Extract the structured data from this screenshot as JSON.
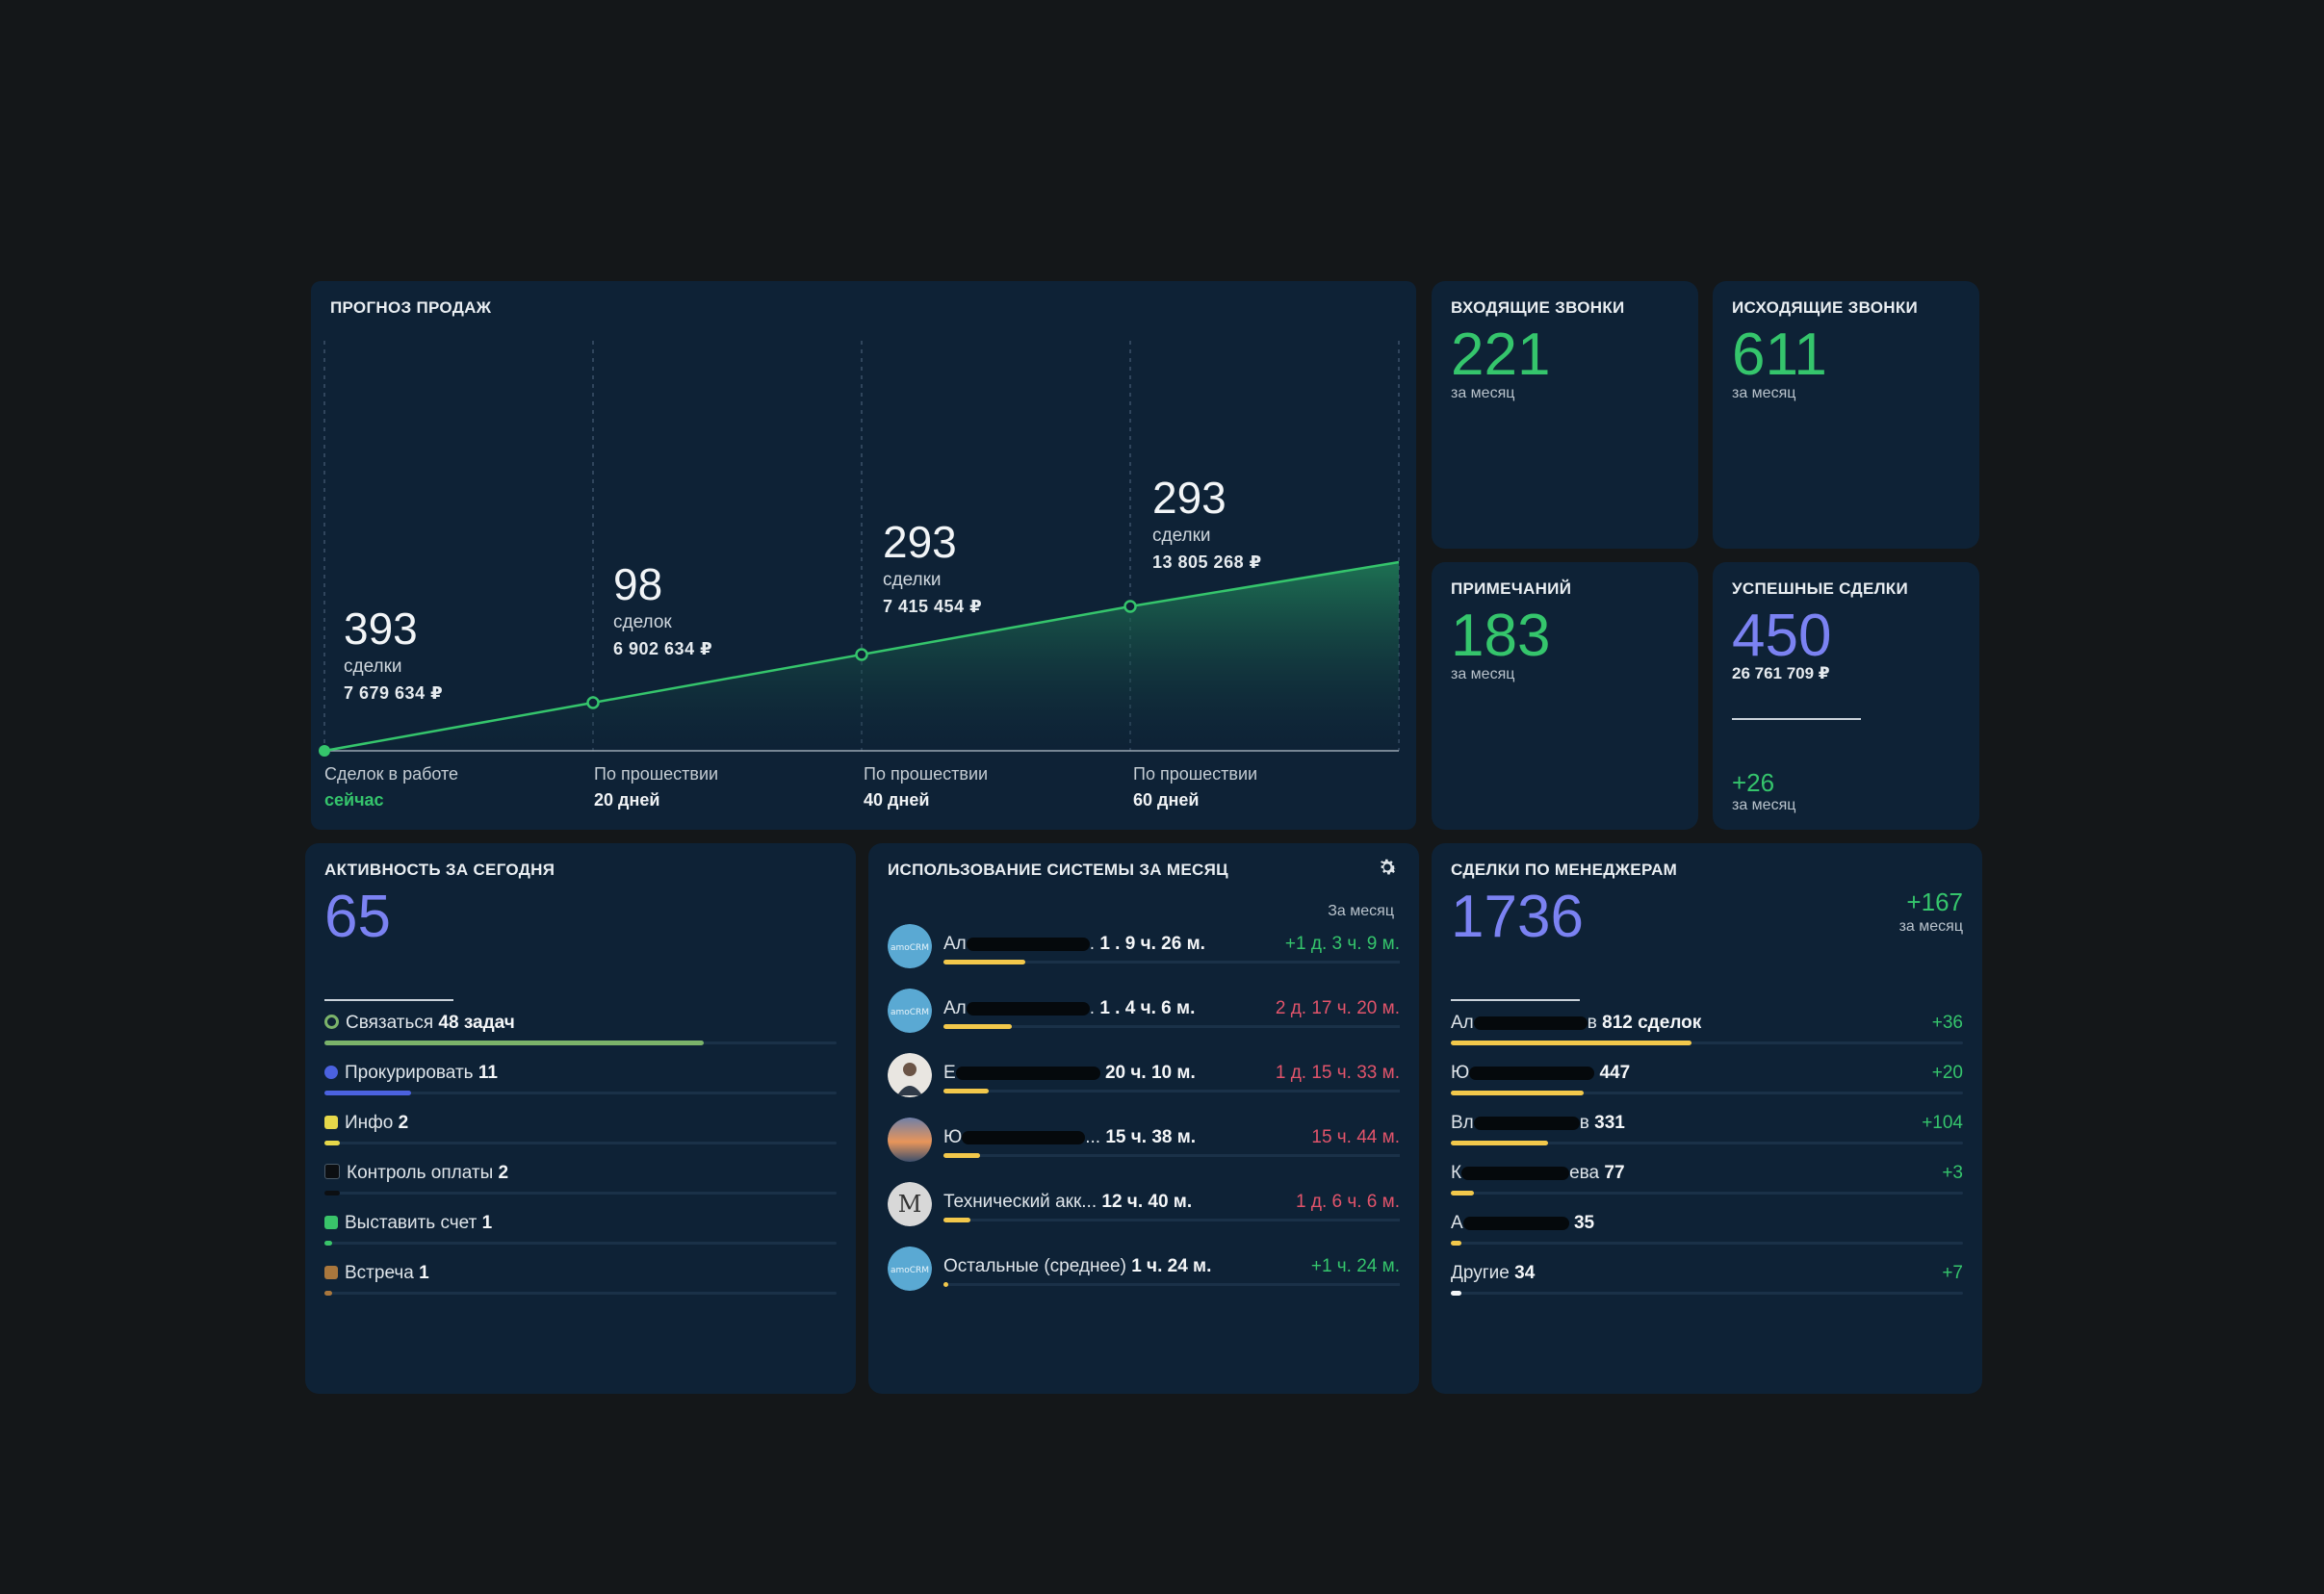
{
  "forecast": {
    "title": "ПРОГНОЗ ПРОДАЖ",
    "stages": [
      {
        "count": "393",
        "unit": "сделки",
        "amount": "7 679 634 ₽",
        "caption": "Сделок в работе",
        "when": "сейчас",
        "value": 0.0
      },
      {
        "count": "98",
        "unit": "сделок",
        "amount": "6 902 634 ₽",
        "caption": "По прошествии",
        "when": "20 дней",
        "value": 0.25
      },
      {
        "count": "293",
        "unit": "сделки",
        "amount": "7 415 454 ₽",
        "caption": "По прошествии",
        "when": "40 дней",
        "value": 0.5
      },
      {
        "count": "293",
        "unit": "сделки",
        "amount": "13 805 268 ₽",
        "caption": "По прошествии",
        "when": "60 дней",
        "value": 0.75
      }
    ],
    "end_value": 0.98,
    "line_color": "#35c56c"
  },
  "stats": {
    "incoming": {
      "title": "ВХОДЯЩИЕ ЗВОНКИ",
      "value": "221",
      "sub": "за месяц"
    },
    "outgoing": {
      "title": "ИСХОДЯЩИЕ ЗВОНКИ",
      "value": "611",
      "sub": "за месяц"
    },
    "notes": {
      "title": "ПРИМЕЧАНИЙ",
      "value": "183",
      "sub": "за месяц"
    },
    "success": {
      "title": "УСПЕШНЫЕ СДЕЛКИ",
      "value": "450",
      "amount": "26 761 709 ₽",
      "delta": "+26",
      "delta_sub": "за месяц"
    }
  },
  "activity": {
    "title": "АКТИВНОСТЬ ЗА СЕГОДНЯ",
    "total": "65",
    "items": [
      {
        "icon": "refresh-icon",
        "label": "Связаться",
        "count": "48 задач",
        "share": 0.74,
        "color": "#7bb36a"
      },
      {
        "icon": "check-circle-icon",
        "label": "Прокурировать",
        "count": "11",
        "share": 0.17,
        "color": "#4b62e0"
      },
      {
        "icon": "chat-icon",
        "label": "Инфо",
        "count": "2",
        "share": 0.03,
        "color": "#e6d84a"
      },
      {
        "icon": "square-icon",
        "label": "Контроль оплаты",
        "count": "2",
        "share": 0.03,
        "color": "#0c0f12"
      },
      {
        "icon": "invoice-icon",
        "label": "Выставить счет",
        "count": "1",
        "share": 0.015,
        "color": "#39c46a"
      },
      {
        "icon": "briefcase-icon",
        "label": "Встреча",
        "count": "1",
        "share": 0.015,
        "color": "#a9773d"
      }
    ]
  },
  "usage": {
    "title": "ИСПОЛЬЗОВАНИЕ СИСТЕМЫ ЗА МЕСЯЦ",
    "period": "За месяц",
    "rows": [
      {
        "avatar": "logo",
        "name_prefix": "Ал",
        "name_suffix": ".",
        "time": "1 . 9 ч. 26 м.",
        "delta": "+1 д. 3 ч. 9 м.",
        "trend": "pos",
        "share": 0.18
      },
      {
        "avatar": "logo",
        "name_prefix": "Ал",
        "name_suffix": ".",
        "time": "1 . 4 ч. 6 м.",
        "delta": "2 д. 17 ч. 20 м.",
        "trend": "neg",
        "share": 0.15
      },
      {
        "avatar": "person",
        "name_prefix": "Е",
        "name_suffix": "",
        "time": "20 ч. 10 м.",
        "delta": "1 д. 15 ч. 33 м.",
        "trend": "neg",
        "share": 0.1
      },
      {
        "avatar": "sunset",
        "name_prefix": "Ю",
        "name_suffix": "...",
        "time": "15 ч. 38 м.",
        "delta": "15 ч. 44 м.",
        "trend": "neg",
        "share": 0.08
      },
      {
        "avatar": "m-logo",
        "name_prefix": "Технический акк...",
        "name_suffix": "",
        "time": "12 ч. 40 м.",
        "delta": "1 д. 6 ч. 6 м.",
        "trend": "neg",
        "share": 0.06
      },
      {
        "avatar": "logo",
        "name_prefix": "Остальные (среднее)",
        "name_suffix": "",
        "time": "1 ч. 24 м.",
        "delta": "+1 ч. 24 м.",
        "trend": "pos",
        "share": 0.01
      }
    ]
  },
  "managers": {
    "title": "СДЕЛКИ ПО МЕНЕДЖЕРАМ",
    "total": "1736",
    "delta": "+167",
    "delta_sub": "за месяц",
    "rows": [
      {
        "prefix": "Ал",
        "mid": "в",
        "count": "812 сделок",
        "delta": "+36",
        "share": 0.47
      },
      {
        "prefix": "Ю",
        "mid": "",
        "count": "447",
        "delta": "+20",
        "share": 0.26
      },
      {
        "prefix": "Вл",
        "mid": "в",
        "count": "331",
        "delta": "+104",
        "share": 0.19
      },
      {
        "prefix": "К",
        "mid": "ева",
        "count": "77",
        "delta": "+3",
        "share": 0.045
      },
      {
        "prefix": "А",
        "mid": "",
        "count": "35",
        "delta": "",
        "share": 0.02
      },
      {
        "prefix": "Другие",
        "mid": "",
        "count": "34",
        "delta": "+7",
        "share": 0.02
      }
    ]
  }
}
